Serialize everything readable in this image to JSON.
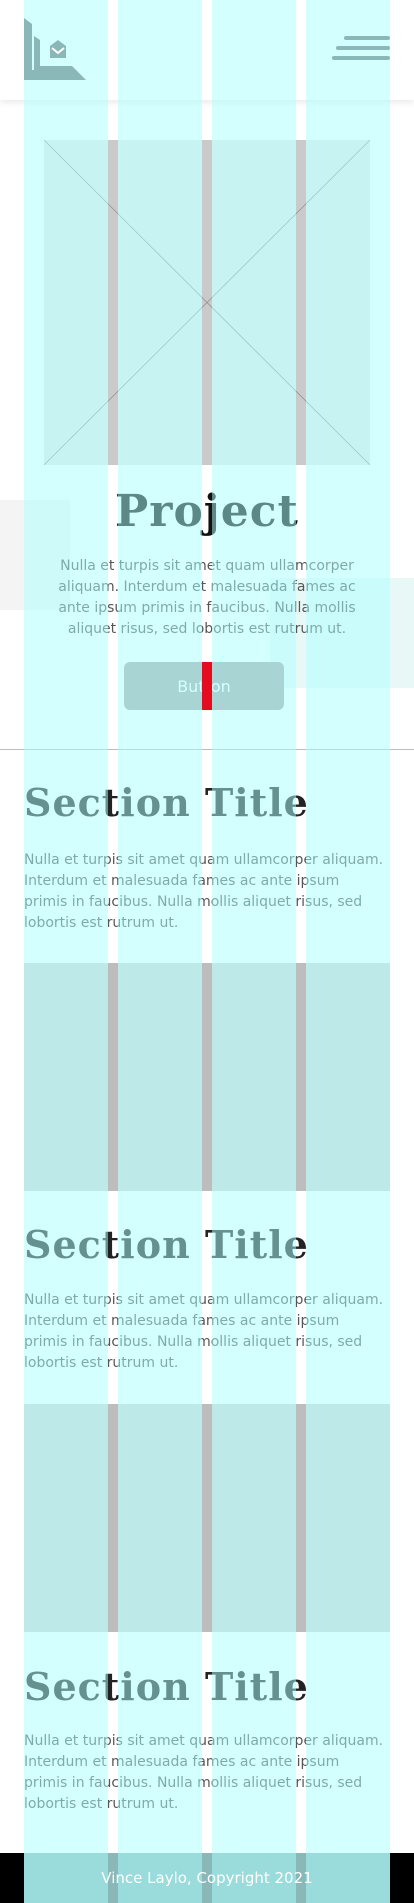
{
  "header": {
    "logo_icon": "logo-mark",
    "menu_icon": "hamburger-icon"
  },
  "hero": {
    "image_icon": "image-placeholder",
    "title": "Project",
    "text": "Nulla et turpis sit amet quam ullamcorper aliquam. Interdum et malesuada fames ac ante ipsum primis in faucibus. Nulla mollis aliquet risus, sed lobortis est rutrum ut.",
    "button_label": "Button"
  },
  "sections": [
    {
      "title": "Section Title",
      "text": "Nulla et turpis sit amet quam ullamcorper aliquam. Interdum et malesuada fames ac ante ipsum primis in faucibus. Nulla mollis aliquet risus, sed lobortis est rutrum ut."
    },
    {
      "title": "Section Title",
      "text": "Nulla et turpis sit amet quam ullamcorper aliquam. Interdum et malesuada fames ac ante ipsum primis in faucibus. Nulla mollis aliquet risus, sed lobortis est rutrum ut."
    },
    {
      "title": "Section Title",
      "text": "Nulla et turpis sit amet quam ullamcorper aliquam. Interdum et malesuada fames ac ante ipsum primis in faucibus. Nulla mollis aliquet risus, sed lobortis est rutrum ut."
    }
  ],
  "footer": {
    "text": "Vince Laylo, Copyright 2021"
  },
  "colors": {
    "grid_overlay": "#aaffff",
    "accent": "#8ab7b7",
    "marker": "#e30d1f"
  }
}
